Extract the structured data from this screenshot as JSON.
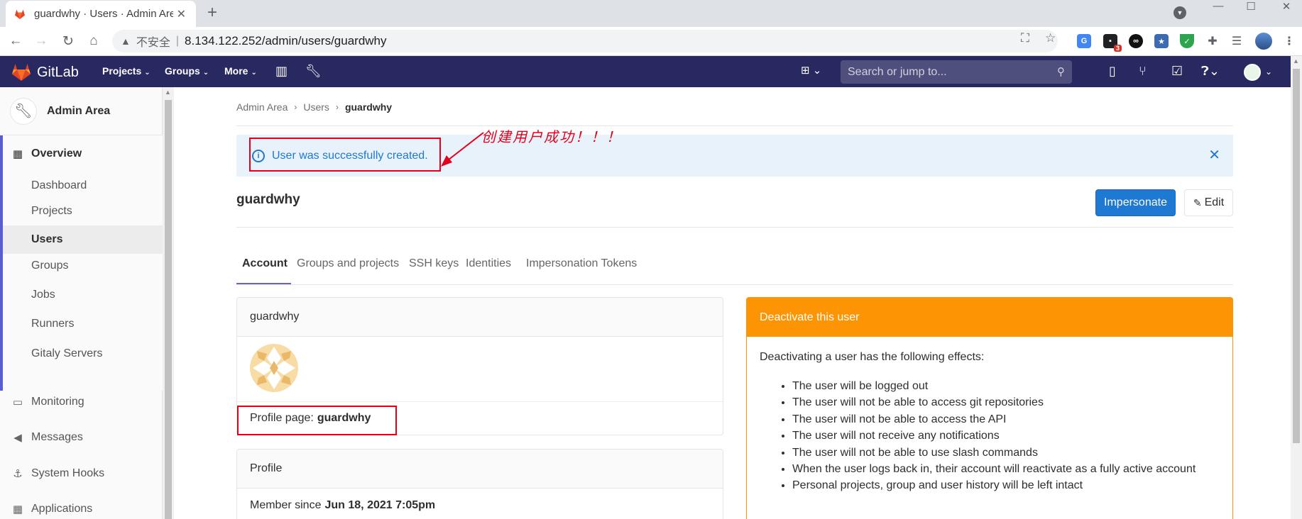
{
  "browser": {
    "tab_title": "guardwhy · Users · Admin Area",
    "insecure_label": "不安全",
    "url": "8.134.122.252/admin/users/guardwhy",
    "ext_badge": "3"
  },
  "gitlab_nav": {
    "logo_text": "GitLab",
    "menus": [
      "Projects",
      "Groups",
      "More"
    ],
    "search_placeholder": "Search or jump to..."
  },
  "sidebar": {
    "context_name": "Admin Area",
    "overview": "Overview",
    "overview_items": [
      "Dashboard",
      "Projects",
      "Users",
      "Groups",
      "Jobs",
      "Runners",
      "Gitaly Servers"
    ],
    "current_item": "Users",
    "sections": [
      "Monitoring",
      "Messages",
      "System Hooks",
      "Applications"
    ]
  },
  "breadcrumb": [
    "Admin Area",
    "Users",
    "guardwhy"
  ],
  "flash": {
    "message": "User was successfully created.",
    "annotation": "创建用户成功！！！"
  },
  "user": {
    "username": "guardwhy",
    "impersonate_label": "Impersonate",
    "edit_label": "Edit"
  },
  "tabs": [
    "Account",
    "Groups and projects",
    "SSH keys",
    "Identities",
    "Impersonation Tokens"
  ],
  "account_card": {
    "header": "guardwhy",
    "profile_label": "Profile page:",
    "profile_value": "guardwhy"
  },
  "profile_card": {
    "header": "Profile",
    "member_since_label": "Member since",
    "member_since_value": "Jun 18, 2021 7:05pm"
  },
  "deactivate": {
    "header": "Deactivate this user",
    "intro": "Deactivating a user has the following effects:",
    "effects": [
      "The user will be logged out",
      "The user will not be able to access git repositories",
      "The user will not be able to access the API",
      "The user will not receive any notifications",
      "The user will not be able to use slash commands",
      "When the user logs back in, their account will reactivate as a fully active account",
      "Personal projects, group and user history will be left intact"
    ]
  },
  "colors": {
    "nav": "#292961",
    "primary": "#1f78d1",
    "warning": "#fc9403",
    "annotation": "#e3001b"
  }
}
